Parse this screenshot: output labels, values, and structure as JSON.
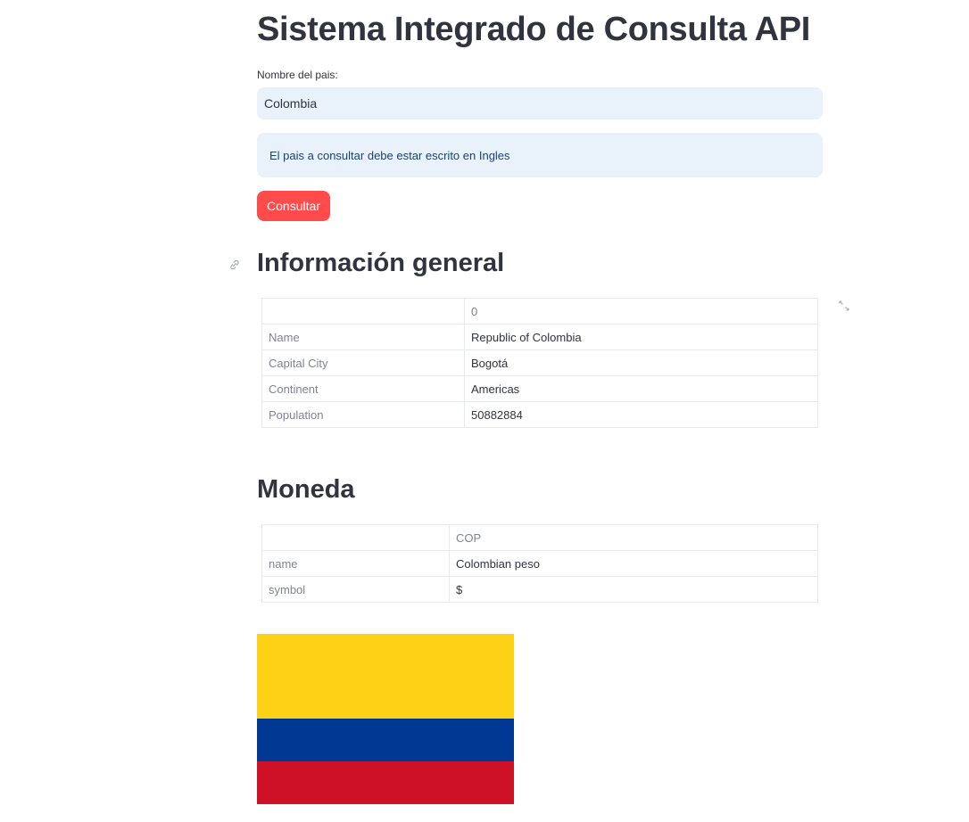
{
  "page": {
    "title": "Sistema Integrado de Consulta API"
  },
  "form": {
    "label": "Nombre del pais:",
    "value": "Colombia",
    "info": "El pais a consultar debe estar escrito en Ingles",
    "button": "Consultar"
  },
  "general": {
    "heading": "Información general",
    "column": "0",
    "rows": [
      {
        "key": "Name",
        "value": "Republic of Colombia"
      },
      {
        "key": "Capital City",
        "value": "Bogotá"
      },
      {
        "key": "Continent",
        "value": "Americas"
      },
      {
        "key": "Population",
        "value": "50882884"
      }
    ]
  },
  "currency": {
    "heading": "Moneda",
    "column": "COP",
    "rows": [
      {
        "key": "name",
        "value": "Colombian peso"
      },
      {
        "key": "symbol",
        "value": "$"
      }
    ]
  },
  "icons": {
    "link": "link-icon",
    "expand": "expand-icon"
  },
  "flag": {
    "colors": [
      "#fcd116",
      "#003893",
      "#ce1126"
    ]
  },
  "colors": {
    "accent": "#ff4b4b",
    "input_bg": "#e9f1fb",
    "info_text": "#1b4370"
  }
}
